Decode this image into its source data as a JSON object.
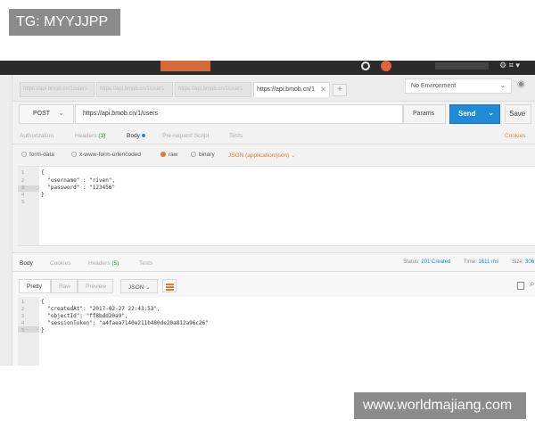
{
  "watermarks": {
    "top": "TG: MYYJJPP",
    "bottom": "www.worldmajiang.com"
  },
  "tabs": [
    {
      "label": "https://api.bmob.cn/1/users"
    },
    {
      "label": "https://api.bmob.cn/1/users"
    },
    {
      "label": "https://api.bmob.cn/1/users"
    },
    {
      "label": "https://api.bmob.cn/1"
    }
  ],
  "new_tab_label": "+",
  "environment": {
    "label": "No Environment"
  },
  "request": {
    "method": "POST",
    "url": "https://api.bmob.cn/1/users",
    "params_label": "Params",
    "send_label": "Send",
    "save_label": "Save"
  },
  "request_tabs": {
    "authorization": "Authorization",
    "headers": "Headers",
    "headers_count": "(3)",
    "body": "Body",
    "prerequest": "Pre-request Script",
    "tests": "Tests",
    "cookies": "Cookies"
  },
  "body_types": {
    "form_data": "form-data",
    "urlencoded": "x-www-form-urlencoded",
    "raw": "raw",
    "binary": "binary",
    "json_select": "JSON (application/json)"
  },
  "request_body_lines": [
    {
      "num": "1",
      "text": "{"
    },
    {
      "num": "2",
      "text": "  \"username\" : \"riven\","
    },
    {
      "num": "3",
      "text": "  \"password\" : \"123456\""
    },
    {
      "num": "4",
      "text": "}"
    },
    {
      "num": "5",
      "text": ""
    }
  ],
  "response_tabs": {
    "body": "Body",
    "cookies": "Cookies",
    "headers": "Headers",
    "headers_count": "(5)",
    "tests": "Tests"
  },
  "response_status": {
    "status_label": "Status:",
    "status_value": "201 Created",
    "time_label": "Time:",
    "time_value": "1611 ms",
    "size_label": "Size:",
    "size_value": "306"
  },
  "response_view": {
    "pretty": "Pretty",
    "raw": "Raw",
    "preview": "Preview",
    "format": "JSON"
  },
  "response_body_lines": [
    {
      "num": "1",
      "text": "{"
    },
    {
      "num": "2",
      "text": "  \"createdAt\": \"2017-02-27 22:43:53\","
    },
    {
      "num": "3",
      "text": "  \"objectId\": \"ff8bdd20a9\","
    },
    {
      "num": "4",
      "text": "  \"sessionToken\": \"a4faea7140e211b480de20a812a96c26\""
    },
    {
      "num": "5",
      "text": "}"
    }
  ],
  "colors": {
    "accent": "#e07a2e",
    "send": "#1f8bd8",
    "titlebar": "#2b2b2b"
  }
}
